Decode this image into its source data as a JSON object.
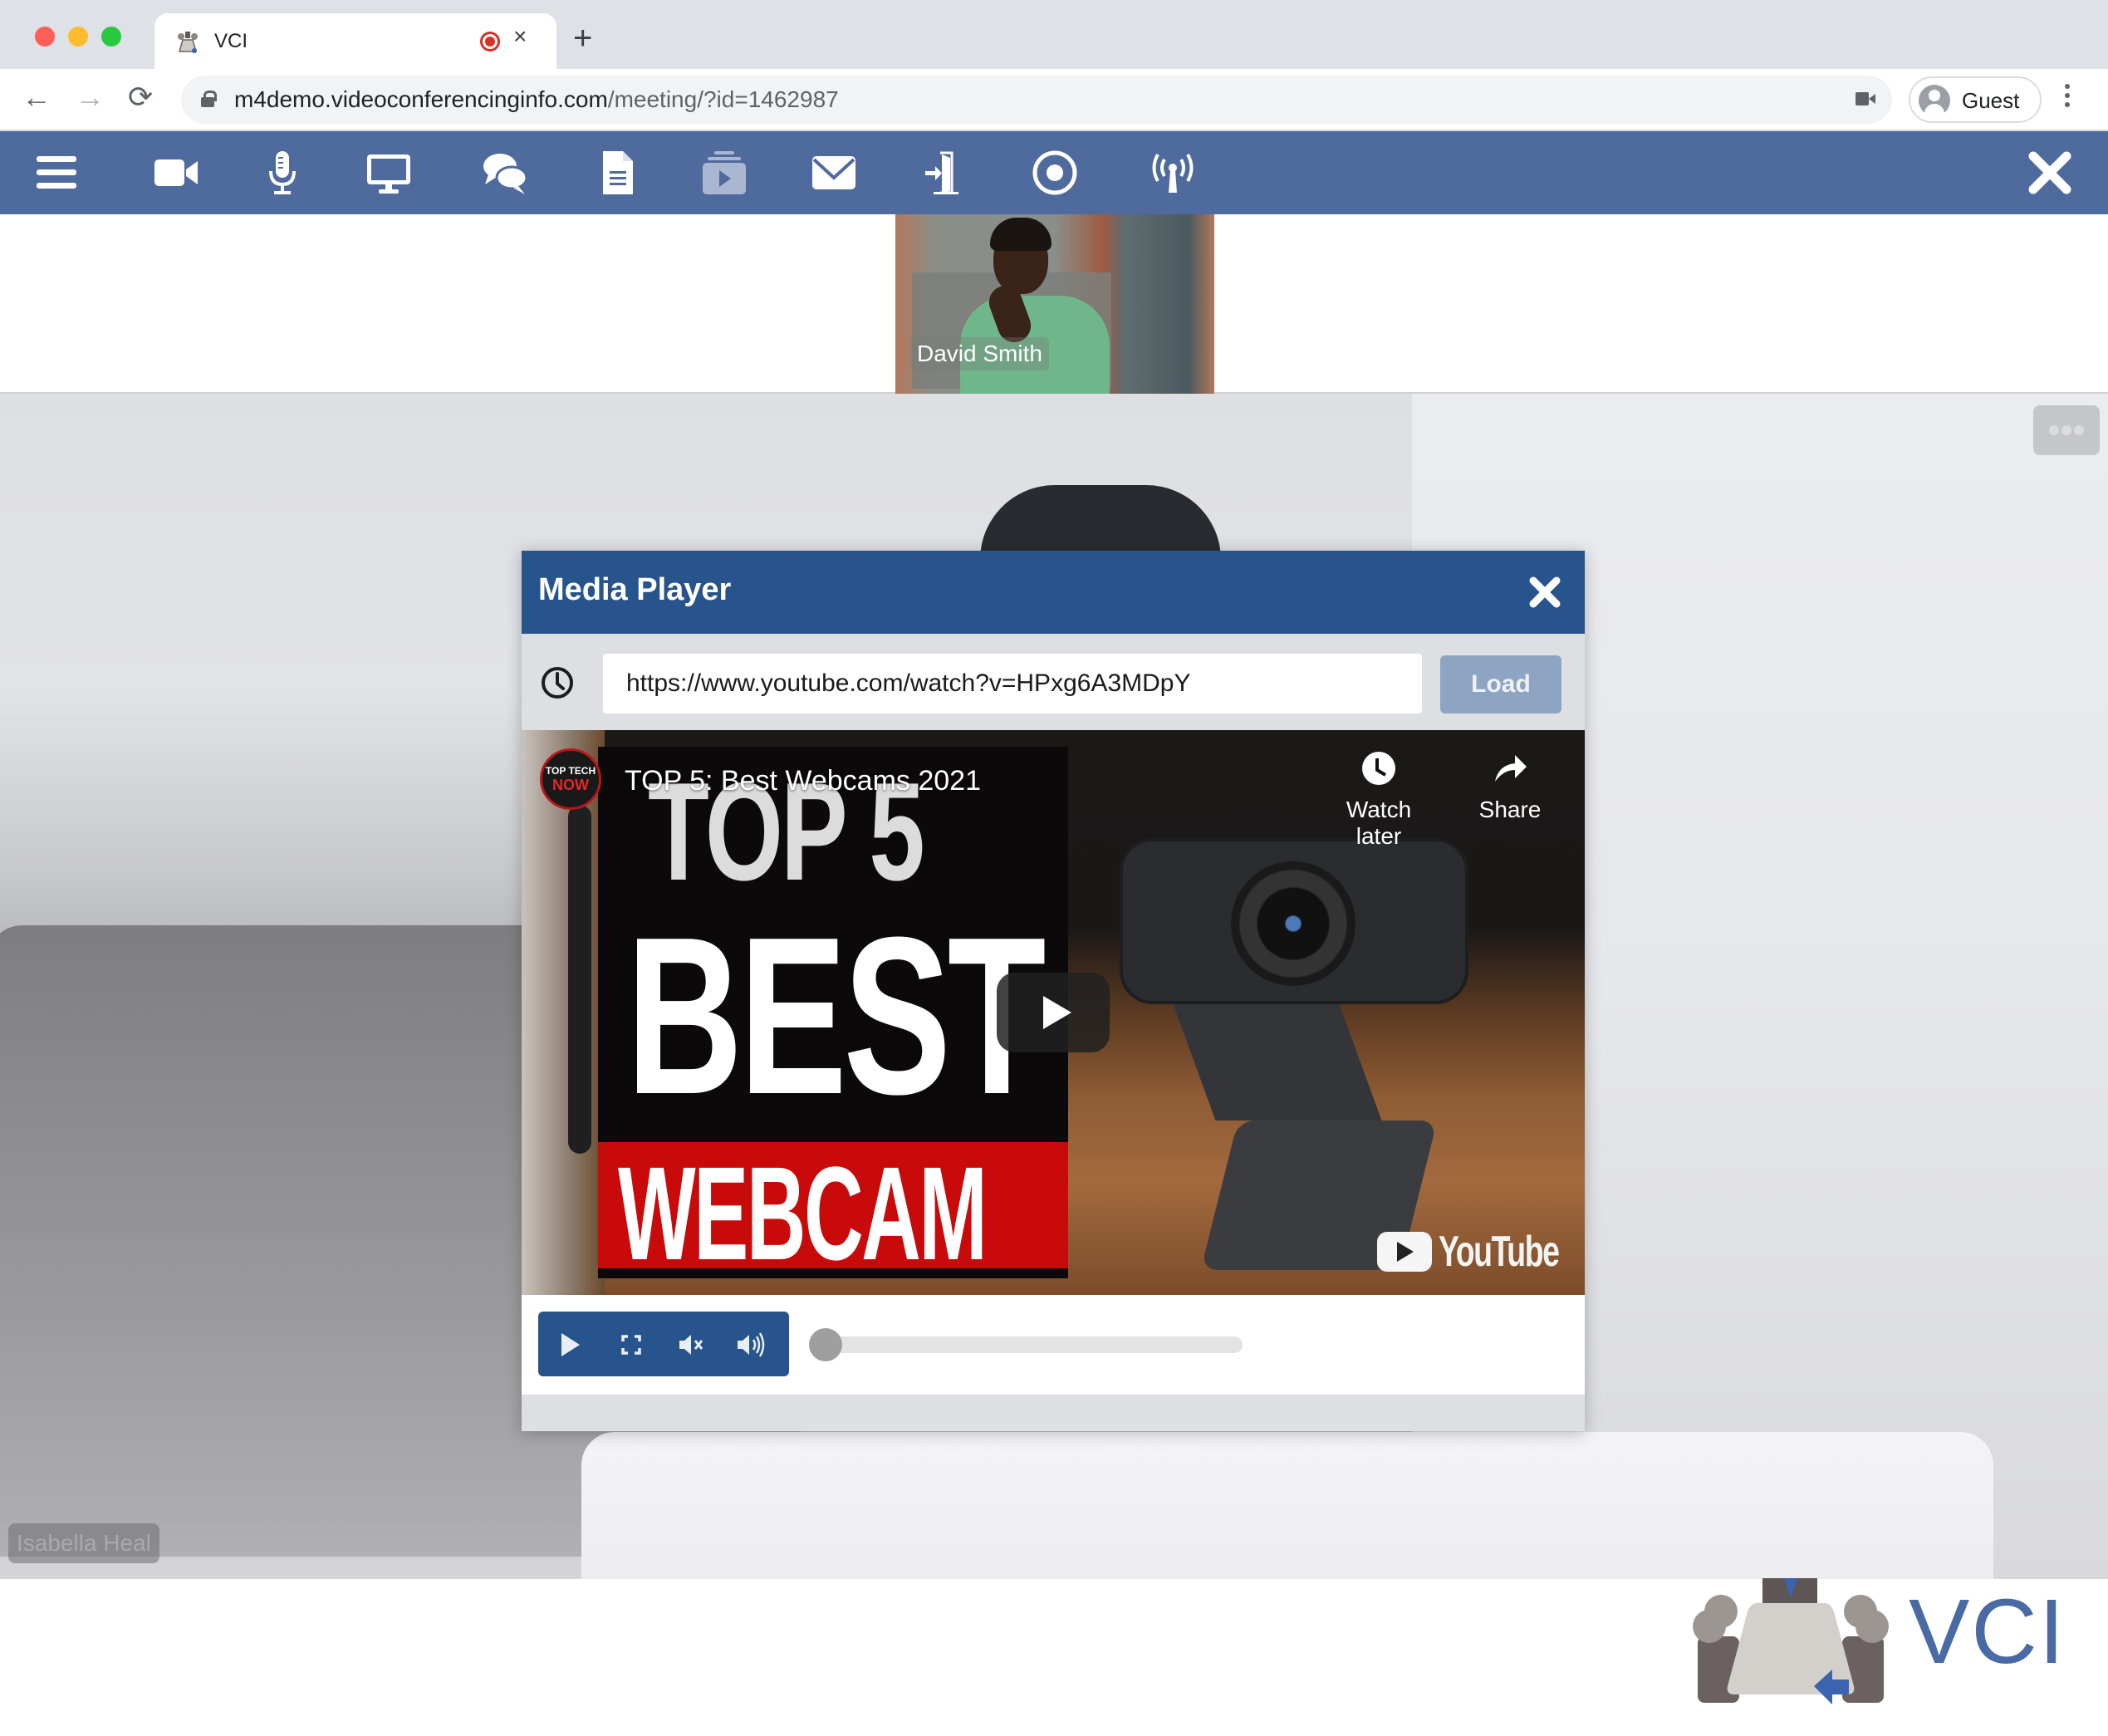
{
  "browser": {
    "tab": {
      "title": "VCI",
      "favicon": "vci-logo-icon",
      "recording_indicator": "record-icon",
      "close_glyph": "×"
    },
    "new_tab_glyph": "+",
    "nav": {
      "back": "←",
      "forward": "→",
      "reload": "⟳"
    },
    "url_host": "m4demo.videoconferencinginfo.com",
    "url_path": "/meeting/?id=1462987",
    "profile_label": "Guest"
  },
  "toolbar": {
    "accent": "#4f6a9c",
    "buttons": [
      {
        "name": "menu",
        "icon": "hamburger-icon"
      },
      {
        "name": "camera",
        "icon": "video-camera-icon"
      },
      {
        "name": "microphone",
        "icon": "microphone-icon"
      },
      {
        "name": "screen-share",
        "icon": "monitor-icon"
      },
      {
        "name": "chat",
        "icon": "chat-bubbles-icon"
      },
      {
        "name": "documents",
        "icon": "document-icon"
      },
      {
        "name": "media-player",
        "icon": "media-playlist-icon",
        "active": true
      },
      {
        "name": "invite",
        "icon": "envelope-icon"
      },
      {
        "name": "leave",
        "icon": "exit-door-icon"
      },
      {
        "name": "record",
        "icon": "record-circle-icon"
      },
      {
        "name": "broadcast",
        "icon": "broadcast-antenna-icon"
      }
    ],
    "close_icon": "close-x-icon"
  },
  "participants": {
    "thumbnails": [
      {
        "name": "David Smith"
      }
    ],
    "main": {
      "name": "Isabella Heal"
    },
    "more_options_icon": "ellipsis-icon"
  },
  "media_player": {
    "title": "Media Player",
    "header_color": "#27548c",
    "url_value": "https://www.youtube.com/watch?v=HPxg6A3MDpY",
    "load_label": "Load",
    "video": {
      "title": "TOP 5: Best Webcams 2021",
      "channel_logo_line1": "TOP TECH",
      "channel_logo_line2": "NOW",
      "thumbnail_text_1": "TOP 5",
      "thumbnail_text_2": "BEST",
      "thumbnail_text_3": "WEBCAM",
      "watch_later_label": "Watch later",
      "share_label": "Share",
      "brand_label": "YouTube"
    },
    "controls": {
      "play_icon": "play-icon",
      "fullscreen_icon": "fullscreen-icon",
      "mute_icon": "mute-icon",
      "volume_icon": "volume-icon",
      "progress": 0.0
    }
  },
  "branding": {
    "logo_text": "VCI",
    "logo_color": "#4a6aa6"
  }
}
